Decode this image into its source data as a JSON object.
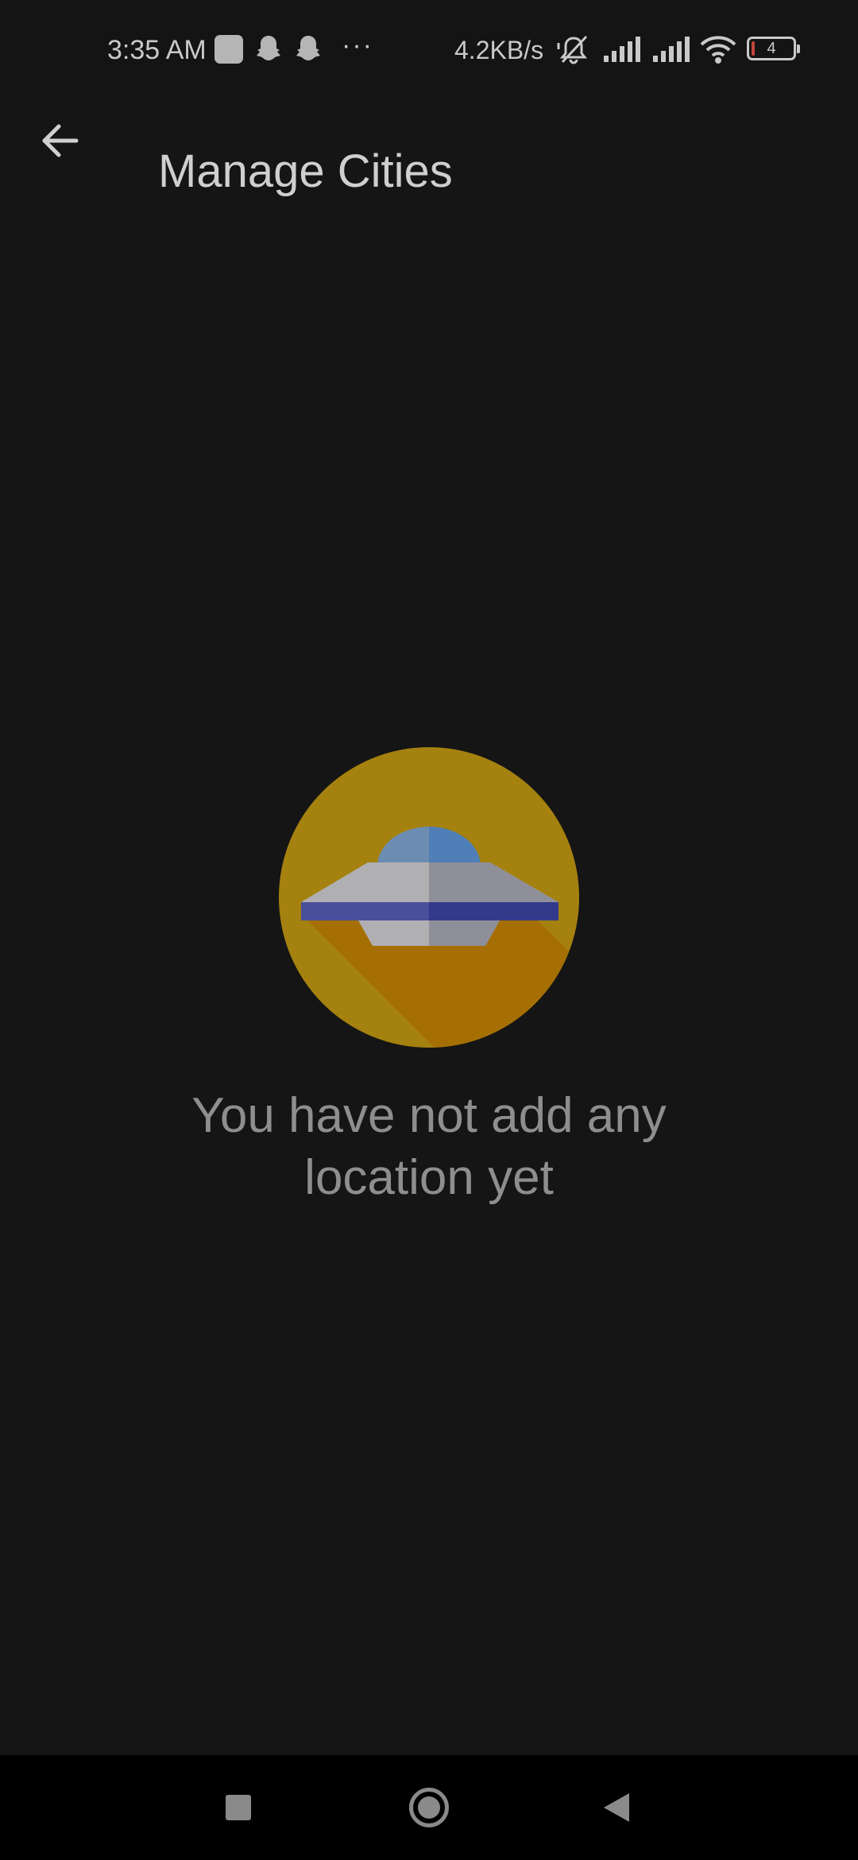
{
  "status_bar": {
    "time": "3:35 AM",
    "notification_icons": [
      "app-square-icon",
      "snapchat-ghost-icon",
      "snapchat-ghost-icon"
    ],
    "overflow": "···",
    "network_speed": "4.2KB/s",
    "system_icons": [
      "mute-bell-icon",
      "signal-icon",
      "signal-icon",
      "wifi-icon"
    ],
    "battery_level": "4",
    "battery_low_color": "#c6453b"
  },
  "app_bar": {
    "title": "Manage Cities",
    "back_icon": "arrow-left-icon"
  },
  "empty_state": {
    "illustration": "ufo-icon",
    "message": "You have not add any location yet",
    "colors": {
      "circle": "#a5810f",
      "shadow": "#a56f03",
      "saucer_band": "#333a8c"
    }
  },
  "nav_bar": {
    "buttons": [
      "recent-apps",
      "home",
      "back"
    ]
  }
}
